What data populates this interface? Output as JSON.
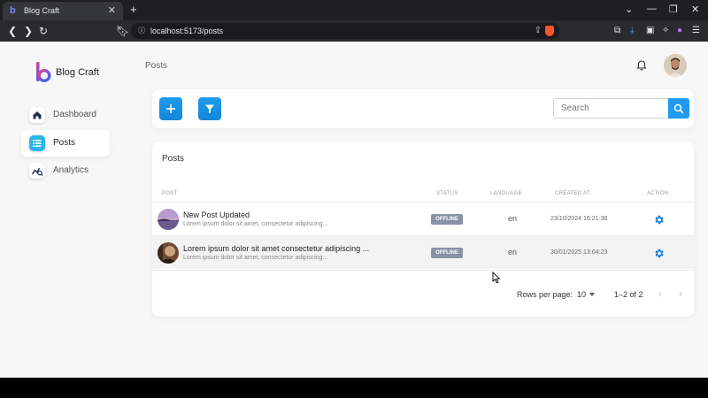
{
  "browser": {
    "tab_title": "Blog Craft",
    "tab_close": "✕",
    "new_tab": "+",
    "url": "localhost:5173/posts",
    "window_controls": [
      "⌄",
      "—",
      "❐",
      "✕"
    ]
  },
  "app": {
    "brand": "Blog Craft",
    "breadcrumb": "Posts"
  },
  "sidebar": {
    "items": [
      {
        "label": "Dashboard",
        "icon": "home-icon",
        "active": false
      },
      {
        "label": "Posts",
        "icon": "list-icon",
        "active": true
      },
      {
        "label": "Analytics",
        "icon": "chart-icon",
        "active": false
      }
    ]
  },
  "actions": {
    "search_placeholder": "Search"
  },
  "posts_card": {
    "title": "Posts",
    "columns": [
      "Post",
      "Status",
      "Language",
      "Created At",
      "Action"
    ],
    "rows": [
      {
        "title": "New Post Updated",
        "excerpt": "Lorem ipsum dolor sit amet, consectetur adipiscing...",
        "status": "OFFLINE",
        "language": "en",
        "created_at": "23/10/2024 16:21:38"
      },
      {
        "title": "Lorem ipsum dolor sit amet consectetur adipiscing ...",
        "excerpt": "Lorem ipsum dolor sit amet, consectetur adipiscing...",
        "status": "OFFLINE",
        "language": "en",
        "created_at": "30/01/2025 13:04:23"
      }
    ],
    "pagination": {
      "rows_per_page_label": "Rows per page:",
      "rows_per_page_value": "10",
      "range": "1–2 of 2",
      "prev": "‹",
      "next": "›"
    }
  },
  "colors": {
    "accent": "#1e9bf0",
    "active_nav_icon": "#29b6e8",
    "status_badge": "#8a93a6",
    "logo_purple": "#7b4fe0"
  }
}
